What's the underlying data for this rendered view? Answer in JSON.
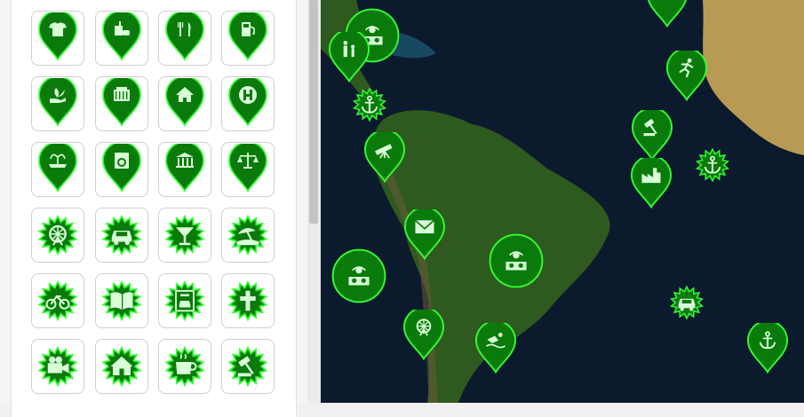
{
  "colors": {
    "marker_fill": "#0a7a0a",
    "marker_stroke": "#33ff33",
    "marker_glyph": "#d8ffd8",
    "ocean": "#0c1a2e",
    "land": "#2f5a1f",
    "desert": "#b89a55"
  },
  "palette": {
    "rows": [
      [
        {
          "shape": "pin",
          "icon": "tshirt-icon"
        },
        {
          "shape": "pin",
          "icon": "fastfood-icon"
        },
        {
          "shape": "pin",
          "icon": "restaurant-icon"
        },
        {
          "shape": "pin",
          "icon": "fuel-icon"
        }
      ],
      [
        {
          "shape": "pin",
          "icon": "plant-hand-icon"
        },
        {
          "shape": "pin",
          "icon": "radiator-icon"
        },
        {
          "shape": "pin",
          "icon": "home-icon"
        },
        {
          "shape": "pin",
          "icon": "hospital-h-icon"
        }
      ],
      [
        {
          "shape": "pin",
          "icon": "fountain-icon"
        },
        {
          "shape": "pin",
          "icon": "laundry-icon"
        },
        {
          "shape": "pin",
          "icon": "bank-icon"
        },
        {
          "shape": "pin",
          "icon": "justice-scale-icon"
        }
      ],
      [
        {
          "shape": "burst",
          "icon": "ferris-wheel-icon"
        },
        {
          "shape": "burst",
          "icon": "car-icon"
        },
        {
          "shape": "burst",
          "icon": "cocktail-icon"
        },
        {
          "shape": "burst",
          "icon": "beach-icon"
        }
      ],
      [
        {
          "shape": "burst",
          "icon": "bicycle-icon"
        },
        {
          "shape": "burst",
          "icon": "book-icon"
        },
        {
          "shape": "burst",
          "icon": "car-rental-icon"
        },
        {
          "shape": "burst",
          "icon": "cemetery-cross-icon"
        }
      ],
      [
        {
          "shape": "burst",
          "icon": "cinema-icon"
        },
        {
          "shape": "burst",
          "icon": "circus-icon"
        },
        {
          "shape": "burst",
          "icon": "coffee-icon"
        },
        {
          "shape": "burst",
          "icon": "court-gavel-icon"
        }
      ]
    ]
  },
  "map": {
    "markers": [
      {
        "shape": "circle",
        "icon": "dj-icon"
      },
      {
        "shape": "pin",
        "icon": "family-icon"
      },
      {
        "shape": "burst",
        "icon": "anchor-icon"
      },
      {
        "shape": "pin",
        "icon": "telescope-icon"
      },
      {
        "shape": "pin",
        "icon": "envelope-icon"
      },
      {
        "shape": "circle",
        "icon": "dj-icon"
      },
      {
        "shape": "circle",
        "icon": "dj-icon"
      },
      {
        "shape": "pin",
        "icon": "ferris-wheel-icon"
      },
      {
        "shape": "pin",
        "icon": "swimming-icon"
      },
      {
        "shape": "pin",
        "icon": "running-icon"
      },
      {
        "shape": "pin",
        "icon": "gavel-icon"
      },
      {
        "shape": "pin",
        "icon": "factory-icon"
      },
      {
        "shape": "burst",
        "icon": "anchor-icon"
      },
      {
        "shape": "burst",
        "icon": "car-icon"
      },
      {
        "shape": "pin",
        "icon": "anchor-icon"
      },
      {
        "shape": "pin",
        "icon": "unknown-icon"
      }
    ]
  }
}
